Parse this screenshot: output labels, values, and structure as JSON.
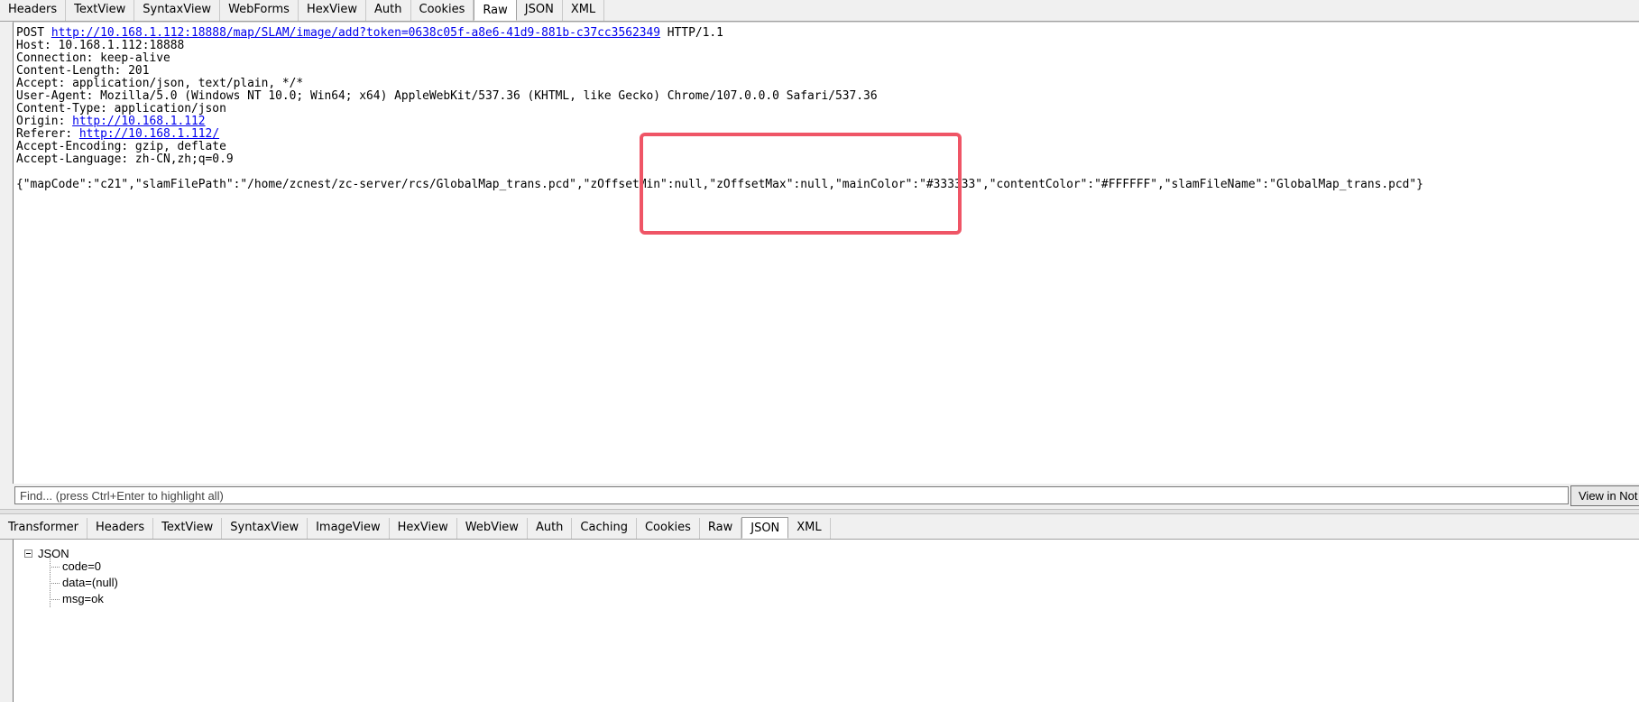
{
  "request_tabs": [
    "Headers",
    "TextView",
    "SyntaxView",
    "WebForms",
    "HexView",
    "Auth",
    "Cookies",
    "Raw",
    "JSON",
    "XML"
  ],
  "request_active_tab": "Raw",
  "request": {
    "method": "POST",
    "url": "http://10.168.1.112:18888/map/SLAM/image/add?token=0638c05f-a8e6-41d9-881b-c37cc3562349",
    "protocol": "HTTP/1.1",
    "host": "Host: 10.168.1.112:18888",
    "connection": "Connection: keep-alive",
    "content_length": "Content-Length: 201",
    "accept": "Accept: application/json, text/plain, */*",
    "user_agent": "User-Agent: Mozilla/5.0 (Windows NT 10.0; Win64; x64) AppleWebKit/537.36 (KHTML, like Gecko) Chrome/107.0.0.0 Safari/537.36",
    "content_type": "Content-Type: application/json",
    "origin_label": "Origin: ",
    "origin_url": "http://10.168.1.112",
    "referer_label": "Referer: ",
    "referer_url": "http://10.168.1.112/",
    "accept_encoding": "Accept-Encoding: gzip, deflate",
    "accept_language": "Accept-Language: zh-CN,zh;q=0.9",
    "body": "{\"mapCode\":\"c21\",\"slamFilePath\":\"/home/zcnest/zc-server/rcs/GlobalMap_trans.pcd\",\"zOffsetMin\":null,\"zOffsetMax\":null,\"mainColor\":\"#333333\",\"contentColor\":\"#FFFFFF\",\"slamFileName\":\"GlobalMap_trans.pcd\"}"
  },
  "find_bar": {
    "placeholder": "Find... (press Ctrl+Enter to highlight all)",
    "button_label": "View in Not"
  },
  "response_tabs": [
    "Transformer",
    "Headers",
    "TextView",
    "SyntaxView",
    "ImageView",
    "HexView",
    "WebView",
    "Auth",
    "Caching",
    "Cookies",
    "Raw",
    "JSON",
    "XML"
  ],
  "response_active_tab": "JSON",
  "json_tree": {
    "root": "JSON",
    "children": [
      "code=0",
      "data=(null)",
      "msg=ok"
    ]
  },
  "colors": {
    "highlight": "#ef5566",
    "link": "#0000ee"
  }
}
